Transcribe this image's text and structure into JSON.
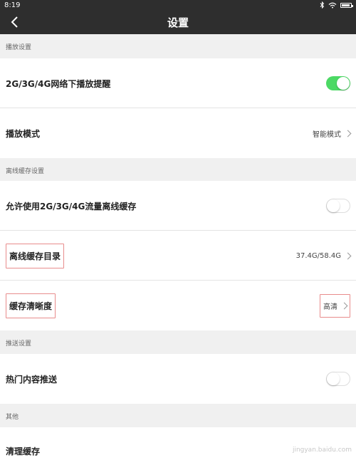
{
  "status_bar": {
    "time": "8:19"
  },
  "nav": {
    "title": "设置",
    "back_icon": "chevron-left-icon"
  },
  "sections": {
    "playback": {
      "header": "播放设置"
    },
    "offline": {
      "header": "离线缓存设置"
    },
    "push": {
      "header": "推送设置"
    },
    "other": {
      "header": "其他"
    }
  },
  "rows": {
    "network_alert": {
      "label": "2G/3G/4G网络下播放提醒",
      "toggle_on": true
    },
    "play_mode": {
      "label": "播放模式",
      "value": "智能模式"
    },
    "allow_cellular_cache": {
      "label": "允许使用2G/3G/4G流量离线缓存",
      "toggle_on": false
    },
    "cache_dir": {
      "label": "离线缓存目录",
      "value": "37.4G/58.4G"
    },
    "cache_quality": {
      "label": "缓存清晰度",
      "value": "高清"
    },
    "hot_push": {
      "label": "热门内容推送",
      "toggle_on": false
    },
    "clear_cache": {
      "label": "清理缓存"
    }
  },
  "colors": {
    "toggle_on": "#4cd964",
    "nav_bg": "#2e2e2e",
    "highlight": "#e88c8c"
  },
  "watermark": "jingyan.baidu.com"
}
